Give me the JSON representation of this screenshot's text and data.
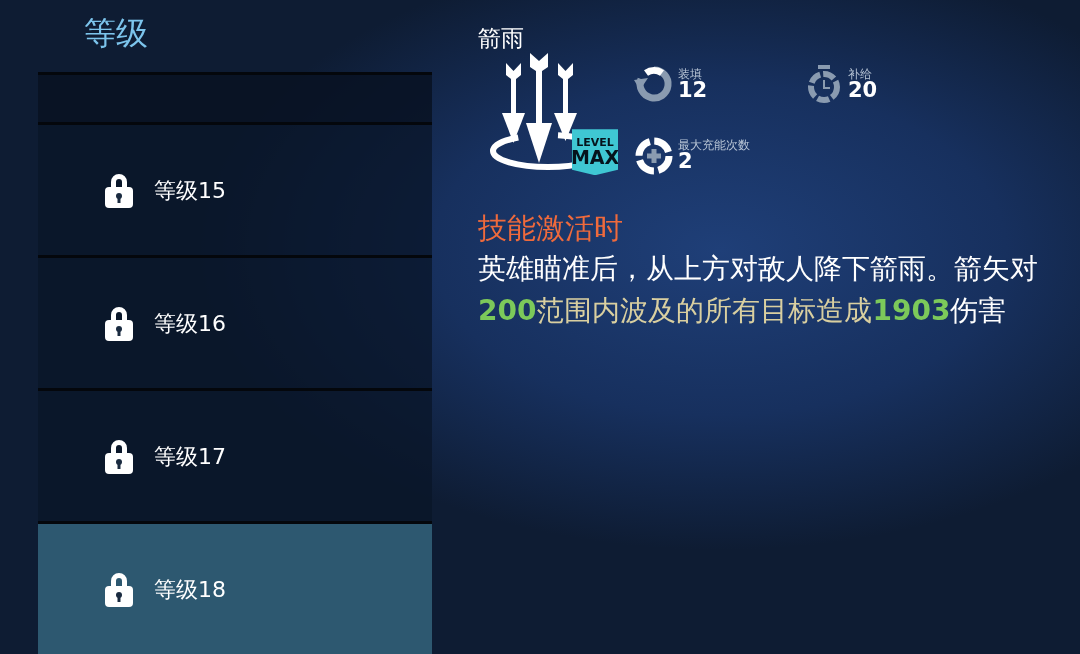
{
  "sidebar": {
    "title": "等级",
    "items": [
      {
        "label": "等级15",
        "locked": true,
        "selected": false
      },
      {
        "label": "等级16",
        "locked": true,
        "selected": false
      },
      {
        "label": "等级17",
        "locked": true,
        "selected": false
      },
      {
        "label": "等级18",
        "locked": true,
        "selected": true
      }
    ]
  },
  "skill": {
    "name": "箭雨",
    "badge": [
      "LEVEL",
      "MAX"
    ],
    "stats": [
      {
        "kind": "reload",
        "label": "装填",
        "value": "12"
      },
      {
        "kind": "supply",
        "label": "补给",
        "value": "20"
      },
      {
        "kind": "charges",
        "label": "最大充能次数",
        "value": "2"
      }
    ],
    "trigger": "技能激活时",
    "description": [
      {
        "kind": "plain",
        "text": "英雄瞄准后，从上方对敌人降下箭雨。箭矢对"
      },
      {
        "kind": "number",
        "text": "200"
      },
      {
        "kind": "highlight",
        "text": "范围内波及的所有目标造成"
      },
      {
        "kind": "number",
        "text": "1903"
      },
      {
        "kind": "plain",
        "text": "伤害"
      }
    ]
  }
}
